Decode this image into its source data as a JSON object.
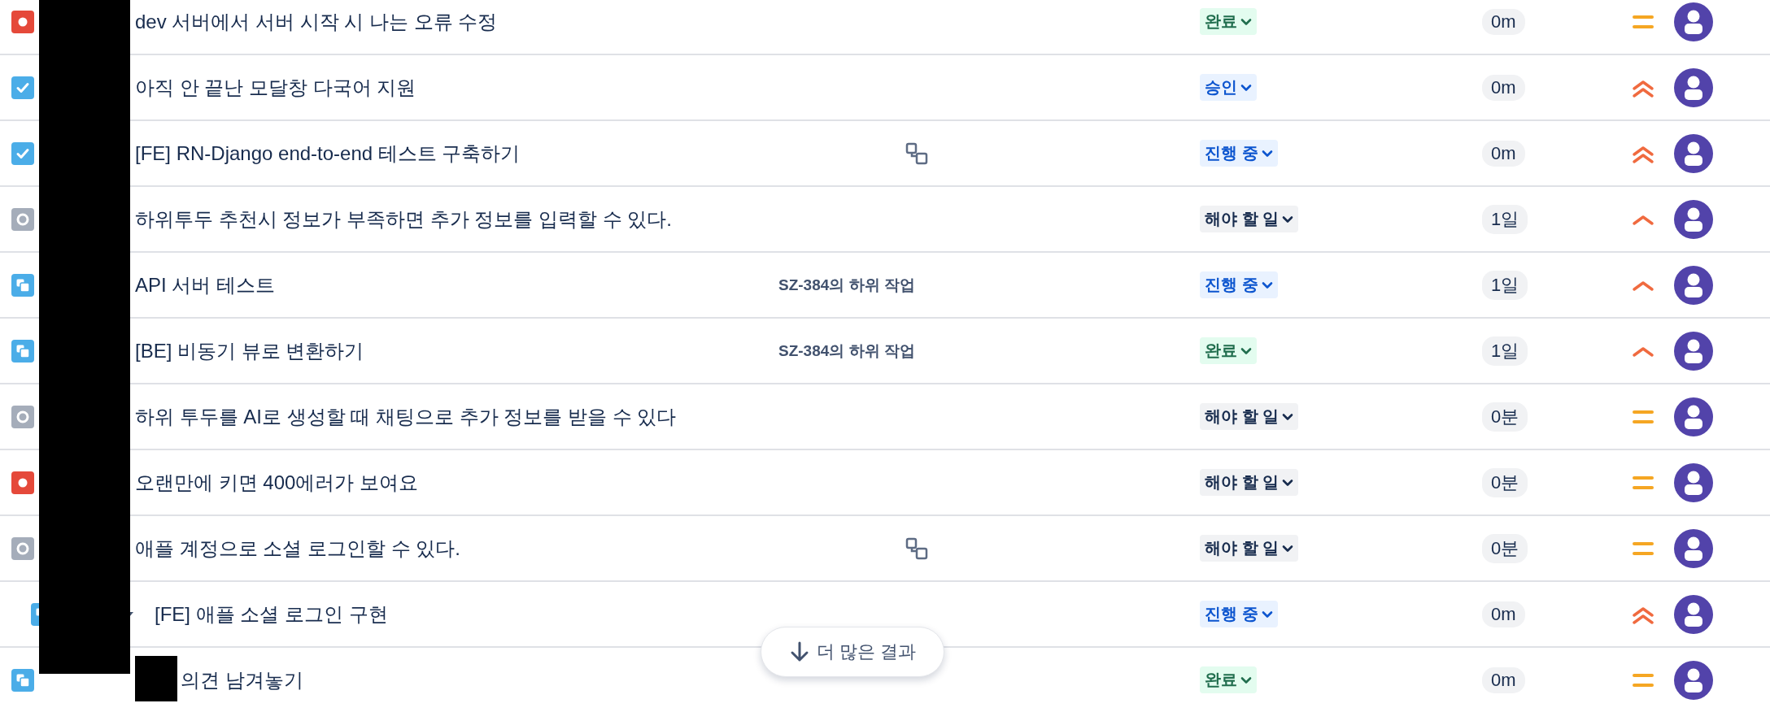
{
  "rows": [
    {
      "issue_type": {
        "kind": "bug"
      },
      "summary": "dev 서버에서 서버 시작 시 나는 오류 수정",
      "status": {
        "label": "완료",
        "kind": "done"
      },
      "time": "0m",
      "priority": {
        "kind": "medium"
      }
    },
    {
      "issue_type": {
        "kind": "story"
      },
      "summary": "아직 안 끝난 모달창 다국어 지원",
      "status": {
        "label": "승인",
        "kind": "progress"
      },
      "time": "0m",
      "priority": {
        "kind": "highest"
      }
    },
    {
      "issue_type": {
        "kind": "story"
      },
      "summary": "[FE] RN-Django end-to-end 테스트 구축하기",
      "child_issues": true,
      "status": {
        "label": "진행 중",
        "kind": "progress"
      },
      "time": "0m",
      "priority": {
        "kind": "highest"
      }
    },
    {
      "issue_type": {
        "kind": "task"
      },
      "summary": "하위투두 추천시 정보가 부족하면 추가 정보를 입력할 수 있다.",
      "status": {
        "label": "해야 할 일",
        "kind": "todo"
      },
      "time": "1일",
      "priority": {
        "kind": "high"
      }
    },
    {
      "issue_type": {
        "kind": "subtask"
      },
      "summary": "API 서버 테스트",
      "parent": "SZ-384의 하위 작업",
      "status": {
        "label": "진행 중",
        "kind": "progress"
      },
      "time": "1일",
      "priority": {
        "kind": "high"
      }
    },
    {
      "issue_type": {
        "kind": "subtask"
      },
      "summary": "[BE] 비동기 뷰로 변환하기",
      "parent": "SZ-384의 하위 작업",
      "status": {
        "label": "완료",
        "kind": "done"
      },
      "time": "1일",
      "priority": {
        "kind": "high"
      }
    },
    {
      "issue_type": {
        "kind": "task"
      },
      "summary": "하위 투두를 AI로 생성할 때 채팅으로 추가 정보를 받을 수 있다",
      "status": {
        "label": "해야 할 일",
        "kind": "todo"
      },
      "time": "0분",
      "priority": {
        "kind": "medium"
      }
    },
    {
      "issue_type": {
        "kind": "bug"
      },
      "summary": "오랜만에 키면 400에러가 보여요",
      "status": {
        "label": "해야 할 일",
        "kind": "todo"
      },
      "time": "0분",
      "priority": {
        "kind": "medium"
      }
    },
    {
      "issue_type": {
        "kind": "task"
      },
      "summary": "애플 계정으로 소셜 로그인할 수 있다.",
      "child_issues": true,
      "status": {
        "label": "해야 할 일",
        "kind": "todo"
      },
      "time": "0분",
      "priority": {
        "kind": "medium"
      },
      "children": [
        {
          "issue_type": {
            "kind": "subtask"
          },
          "summary": "[FE] 애플 소셜 로그인 구현",
          "status": {
            "label": "진행 중",
            "kind": "progress"
          },
          "time": "0m",
          "priority": {
            "kind": "highest"
          }
        }
      ]
    },
    {
      "issue_type": {
        "kind": "subtask"
      },
      "summary": "의견 남겨놓기",
      "redacted_prefix": true,
      "status": {
        "label": "완료",
        "kind": "done"
      },
      "time": "0m",
      "priority": {
        "kind": "medium"
      }
    }
  ],
  "more_button": {
    "label": "더 많은 결과"
  }
}
